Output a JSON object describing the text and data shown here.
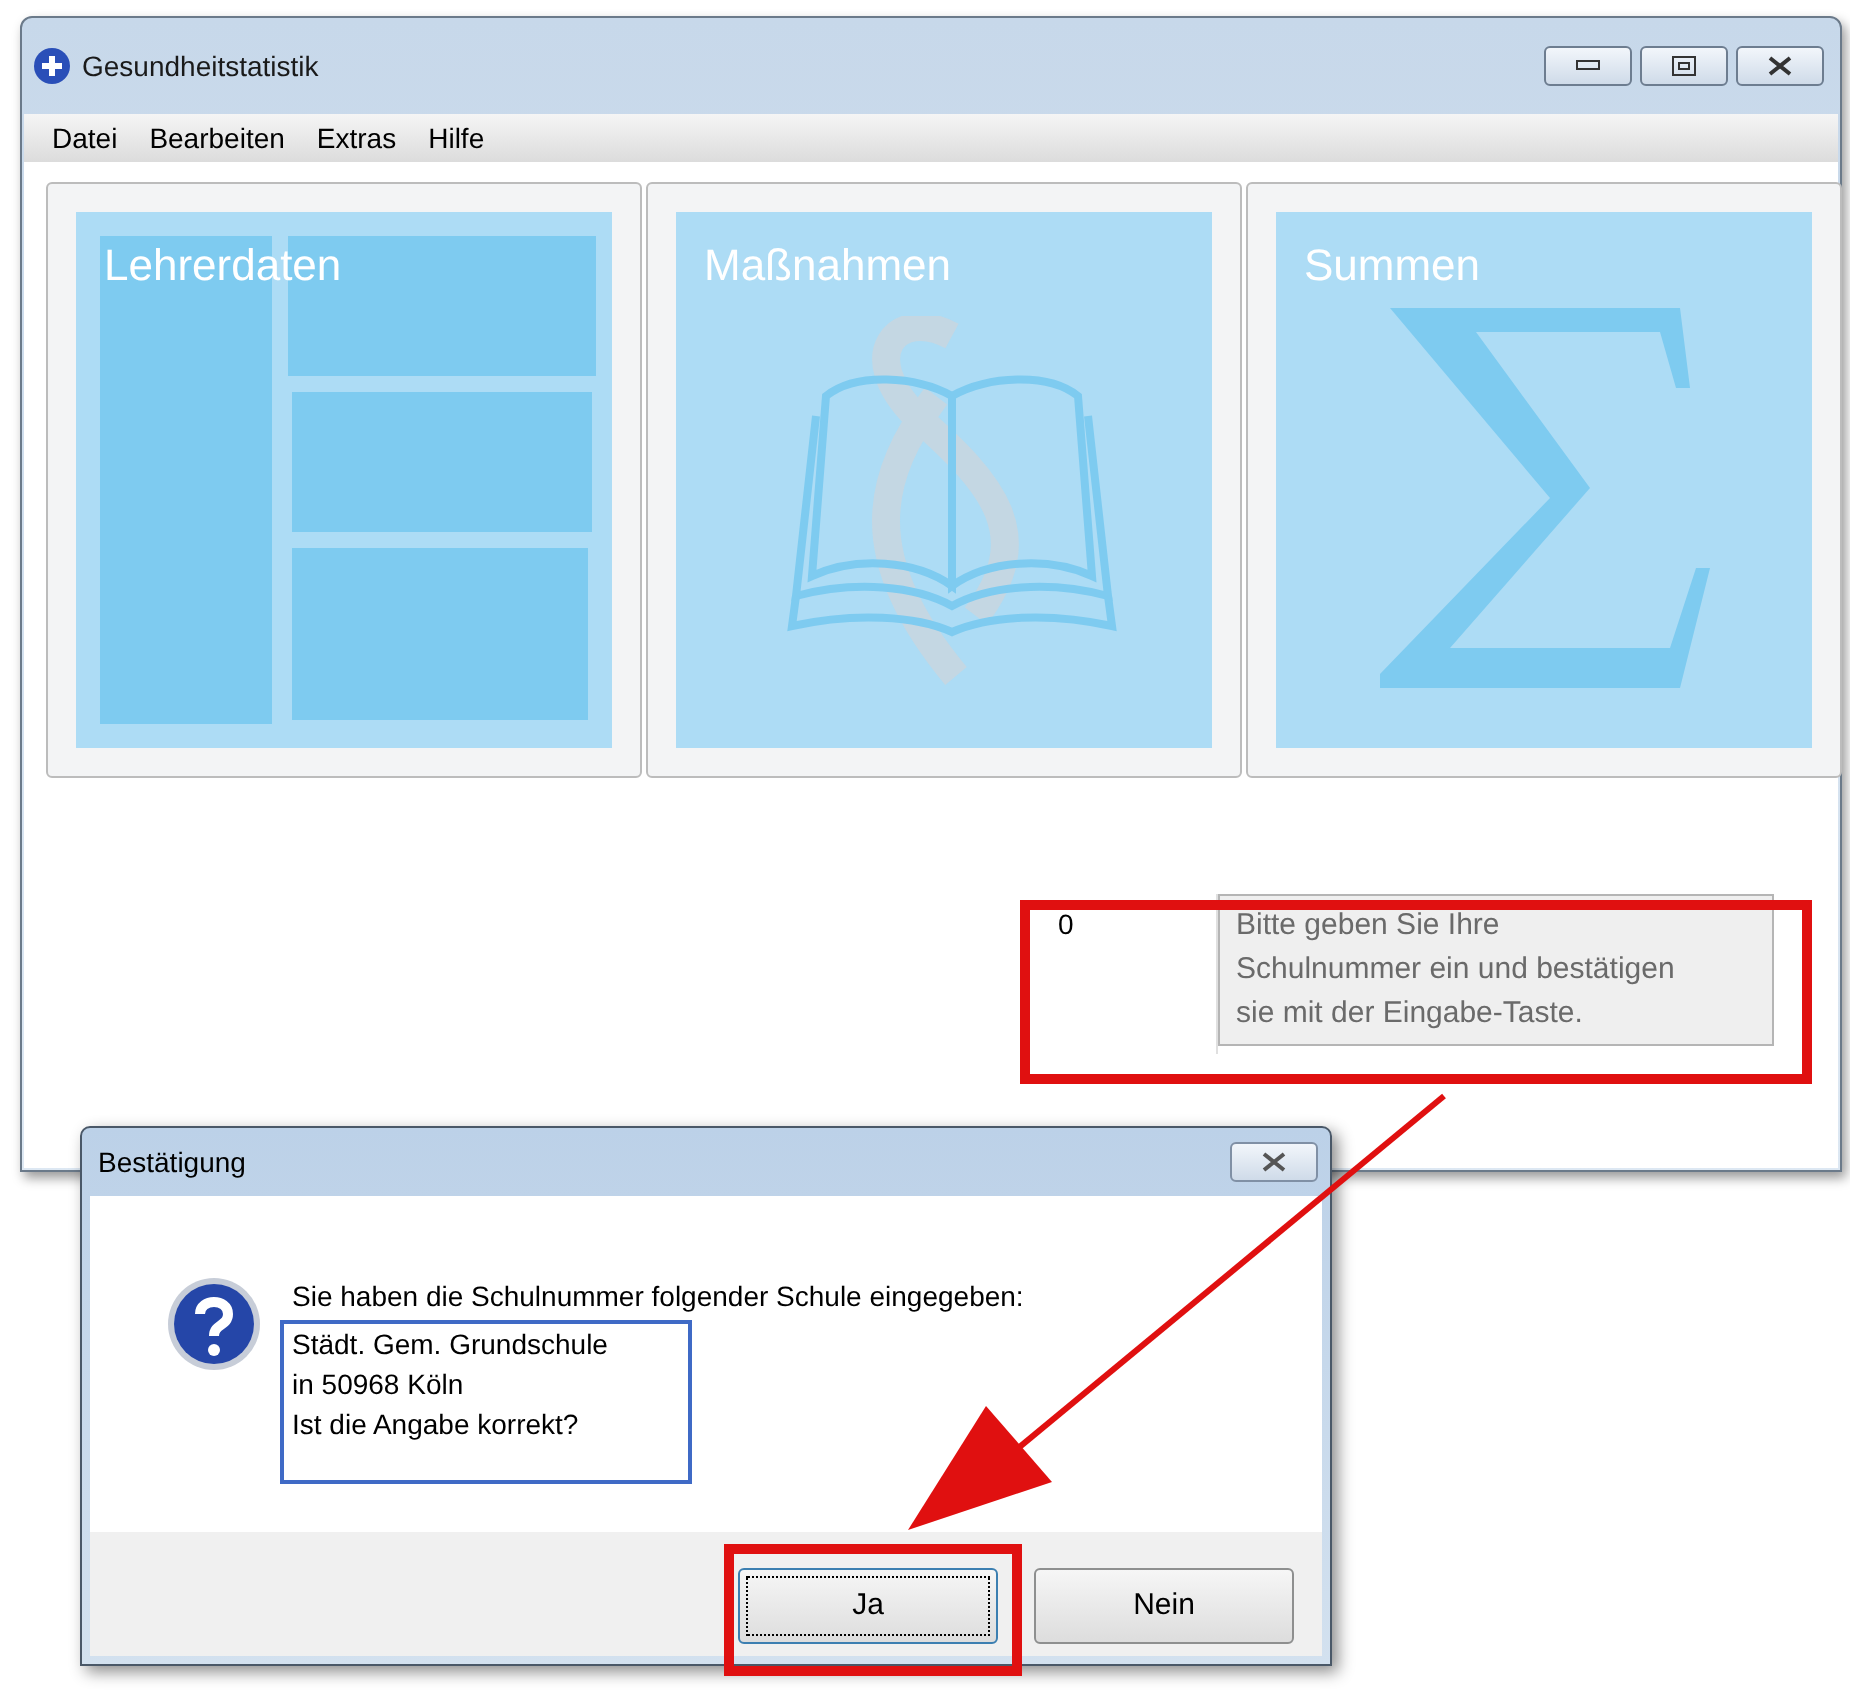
{
  "main_window": {
    "title": "Gesundheitstatistik"
  },
  "menu": [
    {
      "label": "Datei"
    },
    {
      "label": "Bearbeiten"
    },
    {
      "label": "Extras"
    },
    {
      "label": "Hilfe"
    }
  ],
  "tiles": [
    {
      "kind": "layout",
      "label": "Lehrerdaten"
    },
    {
      "kind": "book",
      "label": "Maßnahmen"
    },
    {
      "kind": "sigma",
      "label": "Summen"
    }
  ],
  "school_number": {
    "value": "0",
    "hint": "Bitte geben Sie Ihre Schulnummer ein und bestätigen sie mit der Eingabe-Taste."
  },
  "dialog": {
    "title": "Bestätigung",
    "intro": "Sie haben die Schulnummer folgender Schule eingegeben:",
    "details": [
      "Städt. Gem. Grundschule",
      "in 50968 Köln",
      "Ist die Angabe korrekt?"
    ],
    "buttons": [
      {
        "label": "Ja",
        "default": true
      },
      {
        "label": "Nein",
        "default": false
      }
    ]
  }
}
